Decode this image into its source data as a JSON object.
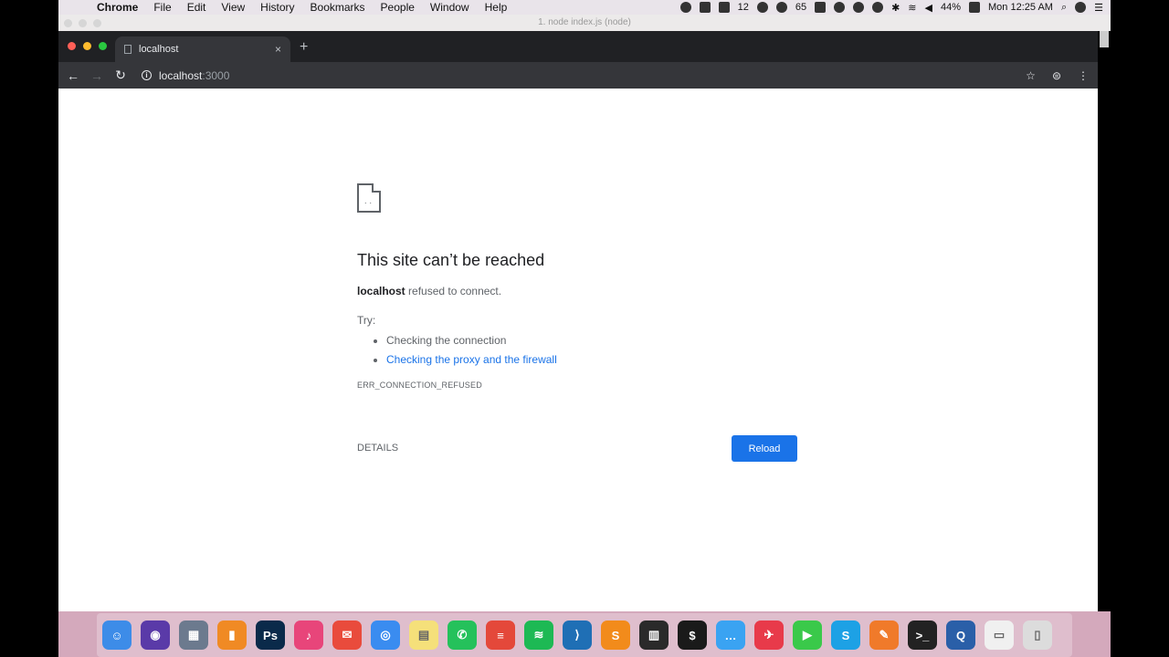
{
  "menubar": {
    "apple_glyph": "",
    "app_name": "Chrome",
    "items": [
      "File",
      "Edit",
      "View",
      "History",
      "Bookmarks",
      "People",
      "Window",
      "Help"
    ],
    "tray": {
      "count_a": "12",
      "count_b": "65",
      "battery": "44%",
      "clock": "Mon 12:25 AM"
    }
  },
  "terminal": {
    "title": "1. node index.js (node)"
  },
  "browser": {
    "tab_title": "localhost",
    "tab_close": "×",
    "new_tab": "+",
    "url_host": "localhost",
    "url_port": ":3000",
    "back": "←",
    "forward": "→",
    "reload": "↻",
    "info": "i",
    "star": "☆",
    "menu": "⋮"
  },
  "error_page": {
    "title": "This site can’t be reached",
    "host": "localhost",
    "message": " refused to connect.",
    "try_label": "Try:",
    "suggestions": [
      "Checking the connection",
      "Checking the proxy and the firewall"
    ],
    "code": "ERR_CONNECTION_REFUSED",
    "details_label": "DETAILS",
    "reload_label": "Reload"
  },
  "dock": {
    "apps": [
      {
        "name": "finder-icon",
        "color": "#3d8ce8",
        "glyph": "☺"
      },
      {
        "name": "siri-icon",
        "color": "#5a3aa8",
        "glyph": "◉"
      },
      {
        "name": "launchpad-icon",
        "color": "#6c7a8e",
        "glyph": "▦"
      },
      {
        "name": "books-icon",
        "color": "#f08a24",
        "glyph": "▮"
      },
      {
        "name": "photoshop-icon",
        "color": "#0a2a4a",
        "glyph": "Ps"
      },
      {
        "name": "itunes-icon",
        "color": "#e8457a",
        "glyph": "♪"
      },
      {
        "name": "mail-icon",
        "color": "#e94b3c",
        "glyph": "✉"
      },
      {
        "name": "chrome-icon",
        "color": "#3a8cf0",
        "glyph": "◎"
      },
      {
        "name": "notes-icon",
        "color": "#f5e07a",
        "glyph": "▤"
      },
      {
        "name": "whatsapp-icon",
        "color": "#25c15b",
        "glyph": "✆"
      },
      {
        "name": "todoist-icon",
        "color": "#e4483a",
        "glyph": "≡"
      },
      {
        "name": "spotify-icon",
        "color": "#1db954",
        "glyph": "≋"
      },
      {
        "name": "vscode-icon",
        "color": "#1f6fb5",
        "glyph": "⟩"
      },
      {
        "name": "sublime-icon",
        "color": "#f28b1b",
        "glyph": "S"
      },
      {
        "name": "istat-icon",
        "color": "#2a2a2a",
        "glyph": "▥"
      },
      {
        "name": "terminal-icon",
        "color": "#1a1a1a",
        "glyph": "$"
      },
      {
        "name": "messages-icon",
        "color": "#3aa3f2",
        "glyph": "…"
      },
      {
        "name": "airmail-icon",
        "color": "#e83a4a",
        "glyph": "✈"
      },
      {
        "name": "facetime-icon",
        "color": "#3ac94a",
        "glyph": "▶"
      },
      {
        "name": "skype-icon",
        "color": "#1da1e5",
        "glyph": "S"
      },
      {
        "name": "postman-icon",
        "color": "#f07a2a",
        "glyph": "✎"
      },
      {
        "name": "iterm-icon",
        "color": "#222",
        "glyph": ">_"
      },
      {
        "name": "quicktime-icon",
        "color": "#2a5fa8",
        "glyph": "Q"
      },
      {
        "name": "downloads-icon",
        "color": "#f0f0f0",
        "glyph": "▭"
      },
      {
        "name": "trash-icon",
        "color": "#dcdcdc",
        "glyph": "▯"
      }
    ]
  }
}
